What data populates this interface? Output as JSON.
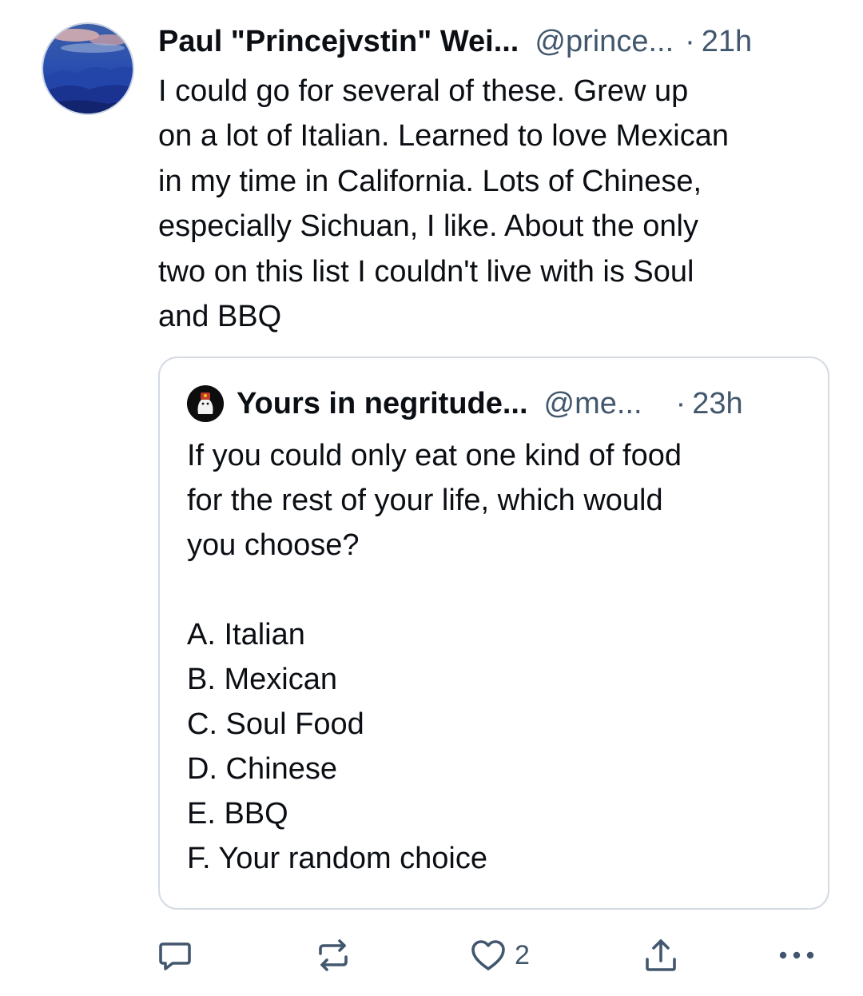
{
  "post": {
    "author_name": "Paul \"Princejvstin\" Wei...",
    "author_handle": "@prince...",
    "separator": "·",
    "time": "21h",
    "text_lines": [
      "I could go for several of these. Grew up",
      "on a lot of Italian. Learned to love Mexican",
      "in my time in California. Lots of Chinese,",
      "especially Sichuan, I like. About the only",
      "two on this list I couldn't live with is Soul",
      "and BBQ"
    ]
  },
  "quote": {
    "author_name": "Yours in negritude...",
    "author_handle": "@me...",
    "separator": "·",
    "time": "23h",
    "question_lines": [
      "If you could only eat one kind of food",
      "for the rest of your life, which would",
      "you choose?"
    ],
    "options": [
      "A. Italian",
      "B. Mexican",
      "C. Soul Food",
      "D. Chinese",
      "E. BBQ",
      "F. Your random choice"
    ]
  },
  "actions": {
    "reply_icon": "reply-icon",
    "repost_icon": "repost-icon",
    "like_icon": "heart-icon",
    "like_count": "2",
    "share_icon": "share-icon",
    "more_icon": "more-icon"
  },
  "colors": {
    "text": "#0b0f14",
    "secondary": "#42576d",
    "border": "#d4dbe3"
  }
}
